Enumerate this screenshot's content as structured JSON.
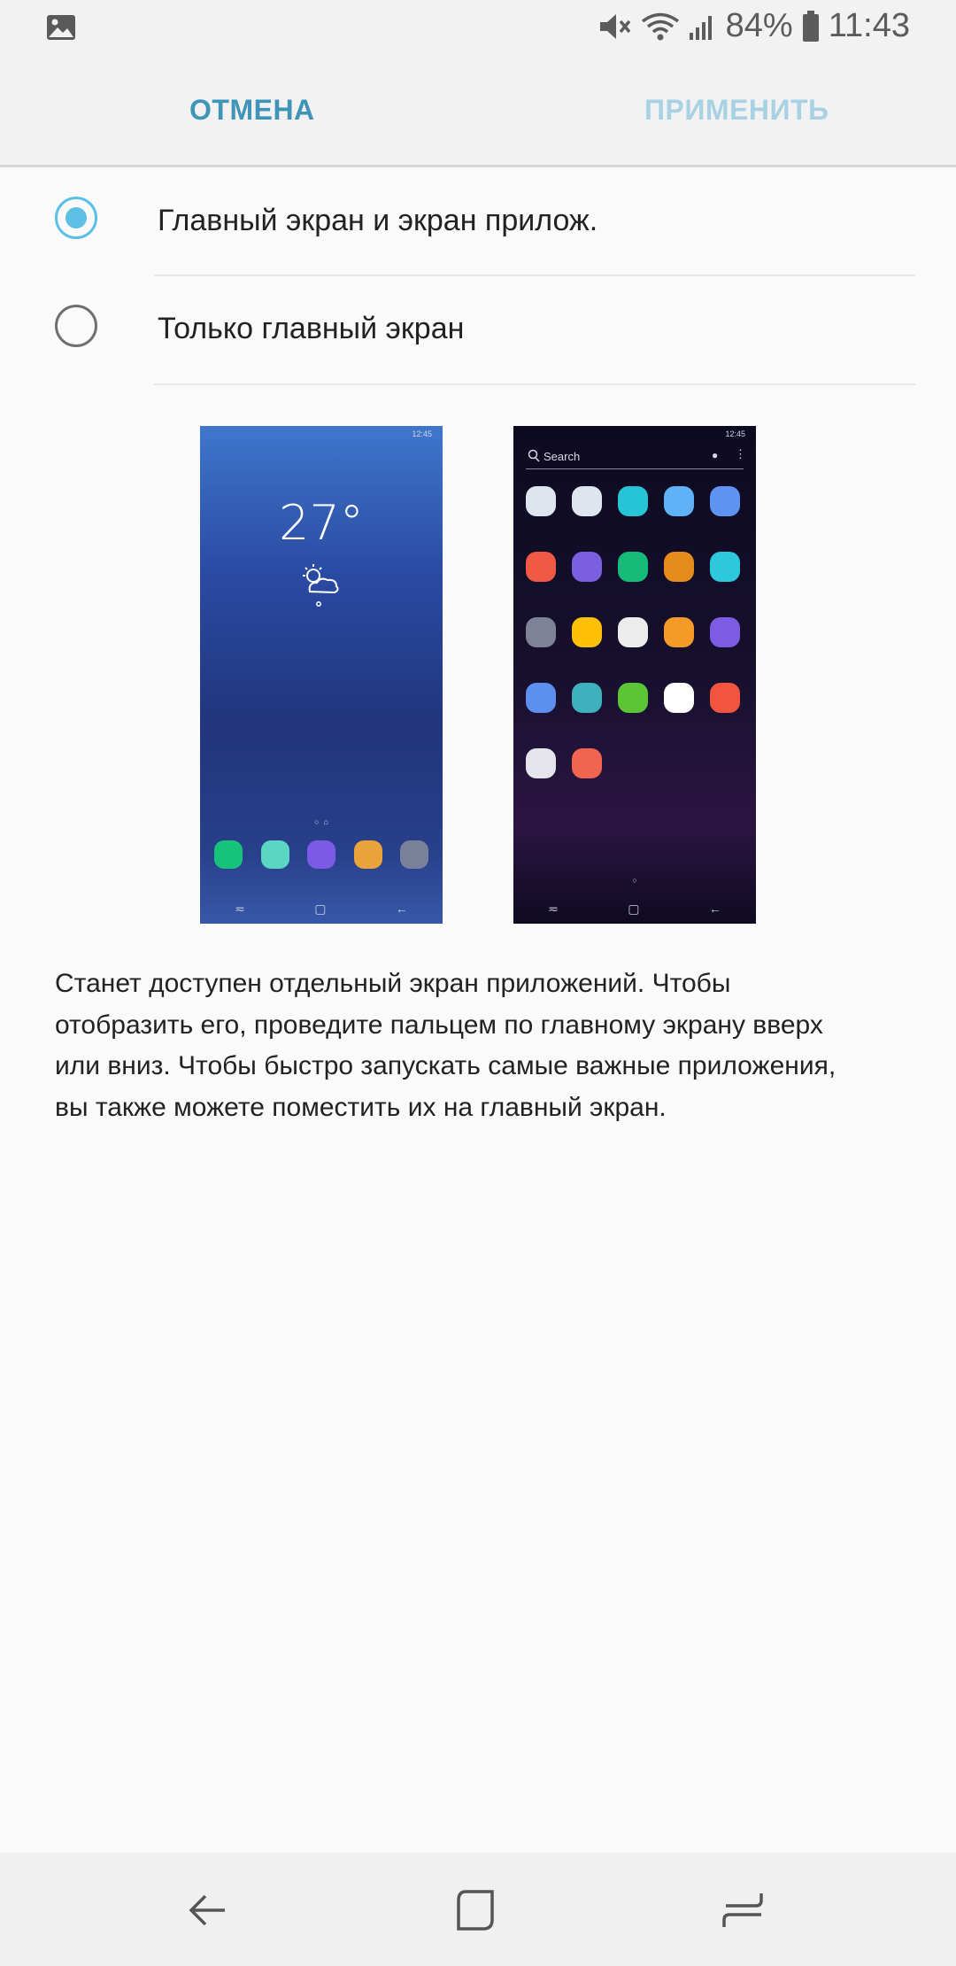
{
  "status_bar": {
    "battery": "84%",
    "time": "11:43",
    "icons": [
      "image-icon",
      "mute-icon",
      "wifi-icon",
      "signal-icon",
      "battery-icon"
    ]
  },
  "header": {
    "cancel_label": "ОТМЕНА",
    "apply_label": "ПРИМЕНИТЬ"
  },
  "options": [
    {
      "label": "Главный экран и экран прилож.",
      "selected": true
    },
    {
      "label": "Только главный экран",
      "selected": false
    }
  ],
  "preview_home": {
    "time": "12:45",
    "temperature": "27°",
    "dock_colors": [
      "#17c27b",
      "#5ad6c3",
      "#7b5be6",
      "#eaa23a",
      "#79809a"
    ]
  },
  "preview_apps": {
    "time": "12:45",
    "search_placeholder": "Search",
    "icon_colors": [
      "#dfe5ee",
      "#dfe5ee",
      "#27c4d6",
      "#5eb2f5",
      "#5e93f2",
      "#f05a44",
      "#7a5fe0",
      "#17ba78",
      "#e78b1d",
      "#2ec8dc",
      "#7d8296",
      "#ffc107",
      "#ececec",
      "#f59b27",
      "#7c5ce2",
      "#5d8ff0",
      "#3fb0bd",
      "#5cc536",
      "#ffffff",
      "#f25440",
      "#e4e4ea",
      "#f06450"
    ]
  },
  "description": "Станет доступен отдельный экран приложений. Чтобы отобразить его, проведите пальцем по главному экрану вверх или вниз. Чтобы быстро запускать самые важные приложения, вы также можете поместить их на главный экран.",
  "navbar": {
    "buttons": [
      "back-icon",
      "home-icon",
      "recents-icon"
    ]
  }
}
